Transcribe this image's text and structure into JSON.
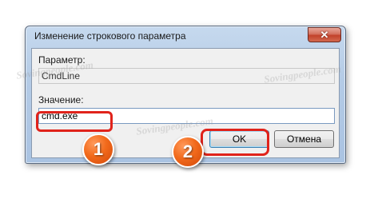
{
  "dialog": {
    "title": "Изменение строкового параметра",
    "close_glyph": "✕"
  },
  "parameter": {
    "label": "Параметр:",
    "value": "CmdLine"
  },
  "value_field": {
    "label": "Значение:",
    "value": "cmd.exe"
  },
  "buttons": {
    "ok_label": "OK",
    "cancel_label": "Отмена"
  },
  "annotations": {
    "step1": "1",
    "step2": "2"
  },
  "watermark": "Sovingpeople.com",
  "colors": {
    "highlight": "#e0231b",
    "badge": "#f26a1b"
  }
}
